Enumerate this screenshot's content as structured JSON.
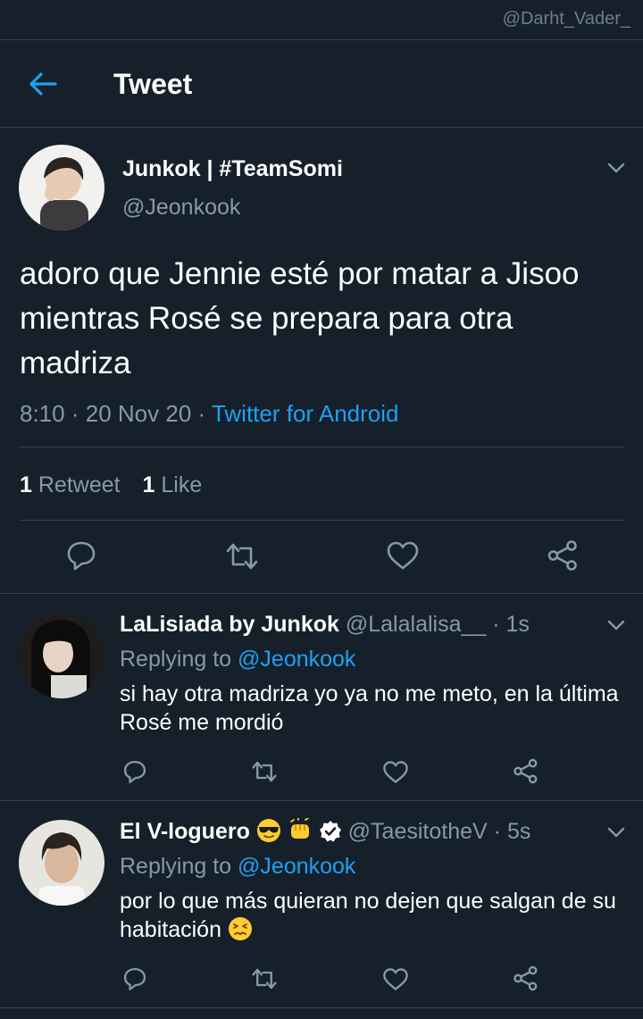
{
  "watermark": "@Darht_Vader_",
  "header": {
    "title": "Tweet"
  },
  "tweet": {
    "display_name": "Junkok | #TeamSomi",
    "handle": "@Jeonkook",
    "text": "adoro que Jennie esté por matar a Jisoo mientras Rosé se prepara para otra madriza",
    "time": "8:10",
    "date": "20 Nov 20",
    "source": "Twitter for Android",
    "separator": "·",
    "retweet_count": "1",
    "retweet_label": "Retweet",
    "like_count": "1",
    "like_label": "Like"
  },
  "replies": [
    {
      "display_name": "LaLisiada by Junkok",
      "handle": "@Lalalalisa__",
      "time_sep": "·",
      "time": "1s",
      "replying_label": "Replying to",
      "replying_handle": "@Jeonkook",
      "text": "si hay otra madriza yo ya no me meto, en la última Rosé me mordió"
    },
    {
      "display_name": "El V-loguero",
      "handle": "@TaesitotheV",
      "time_sep": "·",
      "time": "5s",
      "replying_label": "Replying to",
      "replying_handle": "@Jeonkook",
      "text": "por lo que más quieran no dejen que salgan de su habitación"
    }
  ],
  "colors": {
    "background": "#15202b",
    "accent": "#1da1f2",
    "muted": "#8899a6",
    "divider": "#38444d"
  },
  "icons": {
    "back": "back-arrow-icon",
    "chevron": "chevron-down-icon",
    "reply": "reply-icon",
    "retweet": "retweet-icon",
    "like": "heart-icon",
    "share": "share-icon",
    "verified": "verified-badge-icon"
  }
}
